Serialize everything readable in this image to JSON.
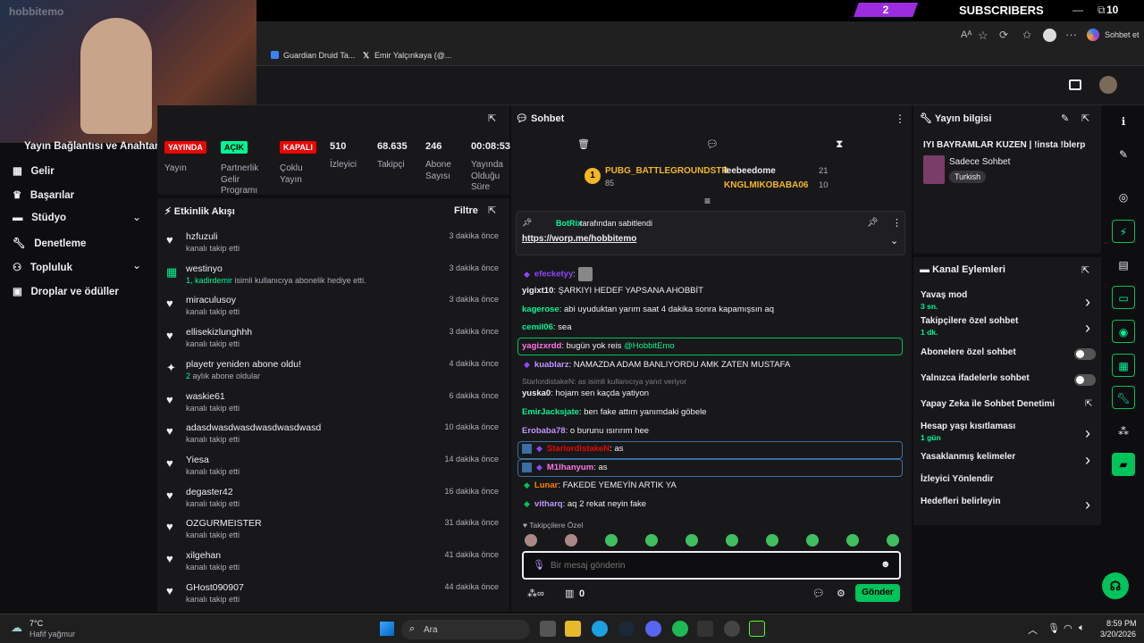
{
  "overlay": {
    "sub_count": "2",
    "sub_label": "SUBSCRIBERS",
    "window_minimize": "—",
    "window_restore": "⧉",
    "window_number": "10"
  },
  "webcam": {
    "watermark": "hobbitemo"
  },
  "browser": {
    "chat_button": "Sohbet et",
    "bookmarks": [
      "Guardian Druid Ta...",
      "Emir Yalçınkaya (@..."
    ]
  },
  "leftnav": {
    "title": "Yayın Bağlantısı ve Anahtarı",
    "items": [
      "Gelir",
      "Başarılar",
      "Stüdyo",
      "Denetleme",
      "Topluluk",
      "Droplar ve ödüller"
    ]
  },
  "stats": [
    {
      "label": "Yayın",
      "value": "YAYINDA"
    },
    {
      "label": "Partnerlik Gelir Programı",
      "value": "AÇIK"
    },
    {
      "label": "Çoklu Yayın",
      "value": "KAPALI"
    },
    {
      "label": "İzleyici",
      "value": "510"
    },
    {
      "label": "Takipçi",
      "value": "68.635"
    },
    {
      "label": "Abone Sayısı",
      "value": "246"
    },
    {
      "label": "Yayında Olduğu Süre",
      "value": "00:08:53"
    }
  ],
  "feed": {
    "title": "Etkinlik Akışı",
    "filter": "Filtre",
    "items": [
      {
        "name": "hzfuzuli",
        "sub": "kanalı takip etti",
        "time": "3 dakika önce",
        "icon": "heart"
      },
      {
        "name": "westinyo",
        "sub_highlight": "1, kadirdemir",
        "sub": " isimli kullanıcıya abonelik hediye etti.",
        "time": "3 dakika önce",
        "icon": "gift"
      },
      {
        "name": "miraculusoy",
        "sub": "kanalı takip etti",
        "time": "3 dakika önce",
        "icon": "heart"
      },
      {
        "name": "ellisekizlunghhh",
        "sub": "kanalı takip etti",
        "time": "3 dakika önce",
        "icon": "heart"
      },
      {
        "name": "playetr yeniden abone oldu!",
        "sub_highlight": "2",
        "sub": " aylık abone oldular",
        "time": "4 dakika önce",
        "icon": "star"
      },
      {
        "name": "waskie61",
        "sub": "kanalı takip etti",
        "time": "6 dakika önce",
        "icon": "heart"
      },
      {
        "name": "adasdwasdwasdwasdwasdwasd",
        "sub": "kanalı takip etti",
        "time": "10 dakika önce",
        "icon": "heart"
      },
      {
        "name": "Yiesa",
        "sub": "kanalı takip etti",
        "time": "14 dakika önce",
        "icon": "heart"
      },
      {
        "name": "degaster42",
        "sub": "kanalı takip etti",
        "time": "16 dakika önce",
        "icon": "heart"
      },
      {
        "name": "OZGURMEISTER",
        "sub": "kanalı takip etti",
        "time": "31 dakika önce",
        "icon": "heart"
      },
      {
        "name": "xilgehan",
        "sub": "kanalı takip etti",
        "time": "41 dakika önce",
        "icon": "heart"
      },
      {
        "name": "GHost090907",
        "sub": "kanalı takip etti",
        "time": "44 dakika önce",
        "icon": "heart"
      }
    ]
  },
  "chat": {
    "title": "Sohbet",
    "leaderboard": {
      "first": "PUBG_BATTLEGROUNDSTR",
      "first_score": "85",
      "second": "leebeedome",
      "second_score": "21",
      "third": "KNGLMIKOBABA06",
      "third_score": "10"
    },
    "pinned": {
      "by": "BotRix",
      "by_suffix": "tarafından sabitlendi",
      "link": "https://worp.me/hobbitemo"
    },
    "messages": [
      {
        "user": "efecketyy",
        "text": "",
        "color": "#9147ff"
      },
      {
        "user": "yigixt10",
        "text": "ŞARKIYI HEDEF YAPSANA AHOBBİT",
        "color": "#efeff1"
      },
      {
        "user": "kagerose",
        "text": "abi uyuduktan yarım saat 4 dakika sonra kapamışsın aq",
        "color": "#00f593"
      },
      {
        "user": "cemil06",
        "text": "sea",
        "color": "#00f593"
      },
      {
        "user": "yagizxrdd",
        "text": "bugün yok reis ",
        "mention": "@HobbitEmo",
        "color": "#ff75e6"
      },
      {
        "user": "kuablarz",
        "text": "NAMAZDA ADAM BANLIYORDU AMK ZATEN MUSTAFA",
        "color": "#bf94ff"
      },
      {
        "reply": "StarlordistakeN: as isimli kullanıcıya yanıt veriyor"
      },
      {
        "user": "yuska0",
        "text": "hojam sen kaçda yatiyon",
        "color": "#efeff1"
      },
      {
        "user": "EmirJacksjate",
        "text": "ben fake attım yanımdaki göbele",
        "color": "#00f593"
      },
      {
        "user": "Erobaba78",
        "text": "o burunu ısırırım hee",
        "color": "#bf94ff"
      },
      {
        "user": "StarlordistakeN",
        "text": "as",
        "color": "#eb0400"
      },
      {
        "user": "M1lhanyum",
        "text": "as",
        "color": "#ff75e6"
      },
      {
        "user": "Lunar",
        "text": "FAKEDE YEMEYİN ARTIK YA",
        "color": "#ff7f00"
      },
      {
        "user": "vitharq",
        "text": "aq 2 rekat neyin fake",
        "color": "#bf94ff"
      }
    ],
    "followers_only": "Takipçilere Özel",
    "input_placeholder": "Bir mesaj gönderin",
    "points": "0",
    "send": "Gönder"
  },
  "info": {
    "title": "Yayın bilgisi",
    "stream_title": "IYI BAYRAMLAR KUZEN | !insta !blerp",
    "category": "Sadece Sohbet",
    "tag": "Turkish"
  },
  "actions": {
    "title": "Kanal Eylemleri",
    "items": [
      {
        "label": "Yavaş mod",
        "sub": "3 sn.",
        "type": "chevron"
      },
      {
        "label": "Takipçilere özel sohbet",
        "sub": "1 dk.",
        "type": "chevron"
      },
      {
        "label": "Abonelere özel sohbet",
        "type": "toggle"
      },
      {
        "label": "Yalnızca ifadelerle sohbet",
        "type": "toggle"
      },
      {
        "label": "Yapay Zeka ile Sohbet Denetimi",
        "type": "external"
      },
      {
        "label": "Hesap yaşı kısıtlaması",
        "sub": "1 gün",
        "type": "chevron"
      },
      {
        "label": "Yasaklanmış kelimeler",
        "type": "chevron"
      },
      {
        "label": "İzleyici Yönlendir",
        "type": "none"
      },
      {
        "label": "Hedefleri belirleyin",
        "type": "chevron"
      }
    ]
  },
  "taskbar": {
    "weather_temp": "7°C",
    "weather_desc": "Hafif yağmur",
    "search": "Ara",
    "time": "8:59 PM",
    "date": "3/20/2026"
  },
  "colors": {
    "accent_green": "#00f593",
    "purple": "#9147ff",
    "live_red": "#eb0400"
  }
}
